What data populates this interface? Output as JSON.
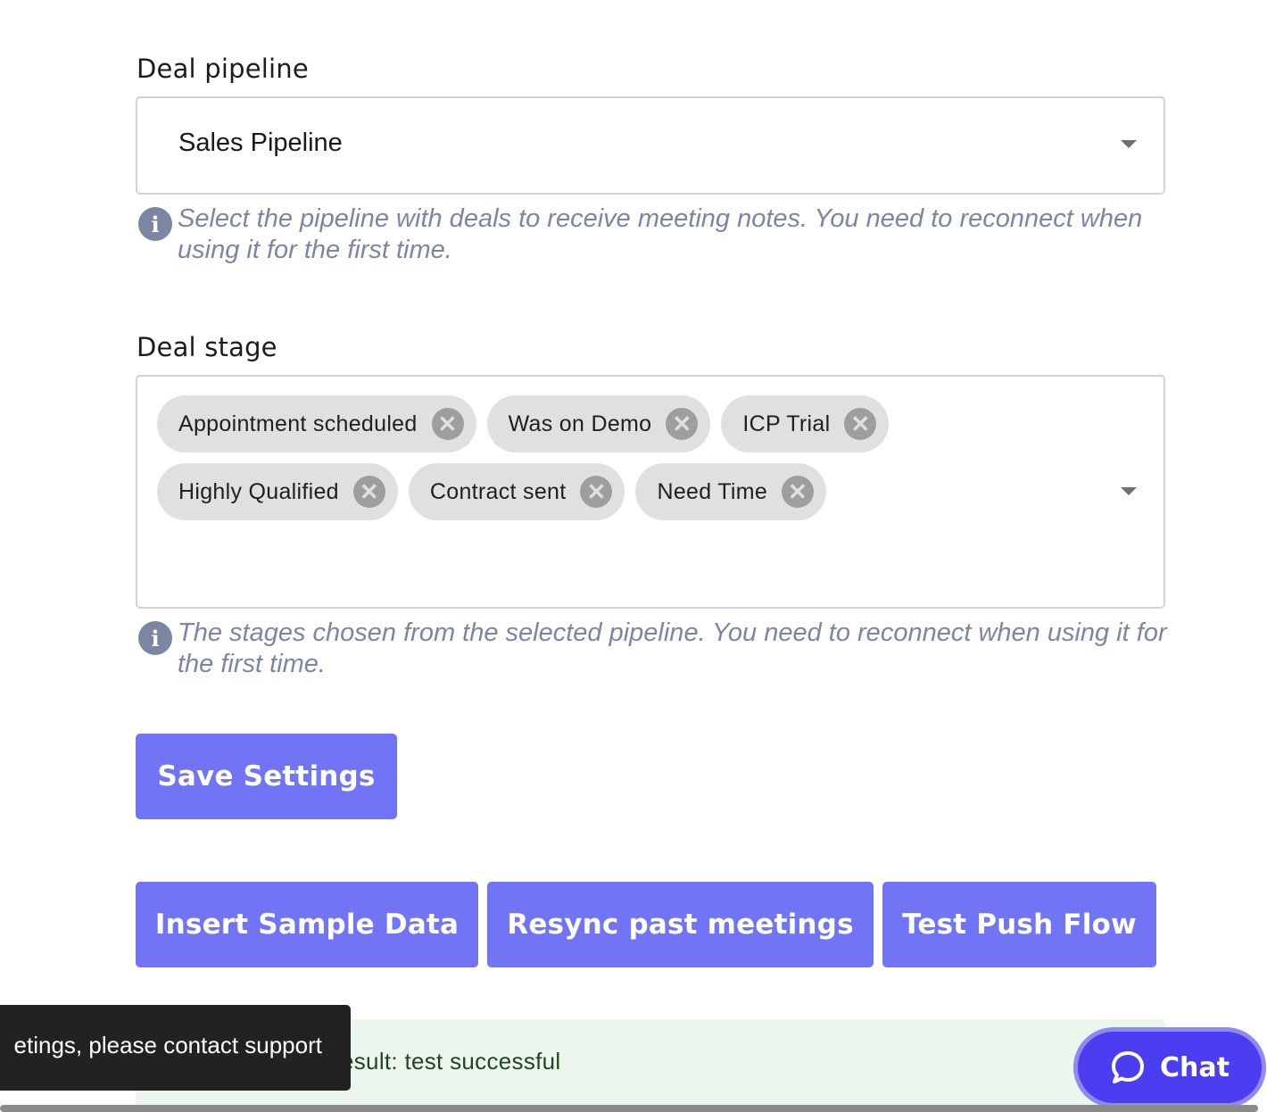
{
  "pipeline": {
    "label": "Deal pipeline",
    "value": "Sales Pipeline",
    "help": "Select the pipeline with deals to receive meeting notes. You need to reconnect when using it for the first time."
  },
  "stage": {
    "label": "Deal stage",
    "chips_row1": [
      "Appointment scheduled",
      "Was on Demo",
      "ICP Trial"
    ],
    "chips_row2": [
      "Highly Qualified",
      "Contract sent",
      "Need Time"
    ],
    "help": "The stages chosen from the selected pipeline. You need to reconnect when using it for the first time."
  },
  "buttons": {
    "save": "Save Settings",
    "insert_sample": "Insert Sample Data",
    "resync": "Resync past meetings",
    "test_push": "Test Push Flow"
  },
  "result": {
    "text": "esult: test successful"
  },
  "toast": {
    "text": "etings, please contact support"
  },
  "chat": {
    "label": "Chat",
    "icon": "chat-bubble-icon"
  },
  "colors": {
    "accent": "#7174f5",
    "chat": "#4a3ef0",
    "help_text": "#7c86a2"
  }
}
